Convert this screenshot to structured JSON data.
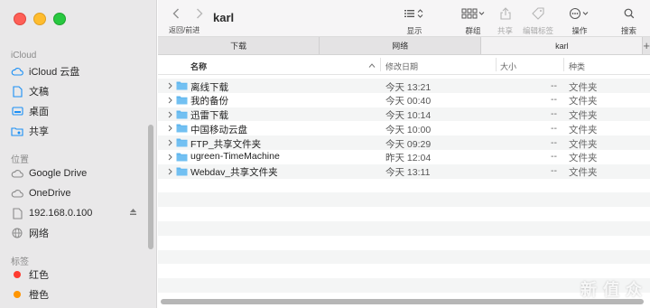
{
  "sidebar": {
    "sections": [
      {
        "title": "iCloud"
      },
      {
        "title": "位置"
      },
      {
        "title": "标签"
      }
    ],
    "icloud_items": [
      {
        "label": "iCloud 云盘",
        "icon": "cloud-icon"
      },
      {
        "label": "文稿",
        "icon": "document-icon"
      },
      {
        "label": "桌面",
        "icon": "desktop-icon"
      },
      {
        "label": "共享",
        "icon": "shared-folder-icon"
      }
    ],
    "location_items": [
      {
        "label": "Google Drive",
        "icon": "cloud-icon"
      },
      {
        "label": "OneDrive",
        "icon": "cloud-icon"
      },
      {
        "label": "192.168.0.100",
        "icon": "document-icon"
      },
      {
        "label": "网络",
        "icon": "globe-icon"
      }
    ],
    "tags": [
      {
        "label": "红色",
        "color": "#fe3b30"
      },
      {
        "label": "橙色",
        "color": "#ff9500"
      }
    ]
  },
  "toolbar": {
    "title": "karl",
    "nav_caption": "返回/前进",
    "view_label": "显示",
    "group_label": "群组",
    "share_label": "共享",
    "tags_label": "编辑标签",
    "action_label": "操作",
    "search_label": "搜索"
  },
  "tabs": [
    {
      "label": "下载",
      "active": false
    },
    {
      "label": "网络",
      "active": false
    },
    {
      "label": "karl",
      "active": true
    }
  ],
  "tab_add": "+",
  "columns": {
    "name": "名称",
    "date": "修改日期",
    "size": "大小",
    "kind": "种类"
  },
  "rows": [
    {
      "name": "离线下载",
      "date": "今天 13:21",
      "size": "--",
      "kind": "文件夹"
    },
    {
      "name": "我的备份",
      "date": "今天 00:40",
      "size": "--",
      "kind": "文件夹"
    },
    {
      "name": "迅雷下载",
      "date": "今天 10:14",
      "size": "--",
      "kind": "文件夹"
    },
    {
      "name": "中国移动云盘",
      "date": "今天 10:00",
      "size": "--",
      "kind": "文件夹"
    },
    {
      "name": "FTP_共享文件夹",
      "date": "今天 09:29",
      "size": "--",
      "kind": "文件夹"
    },
    {
      "name": "ugreen-TimeMachine",
      "date": "昨天 12:04",
      "size": "--",
      "kind": "文件夹"
    },
    {
      "name": "Webdav_共享文件夹",
      "date": "今天 13:11",
      "size": "--",
      "kind": "文件夹"
    }
  ],
  "watermark": "新 值 众",
  "colors": {
    "accent": "#1a8ff5",
    "folder": "#5fb5ee"
  }
}
